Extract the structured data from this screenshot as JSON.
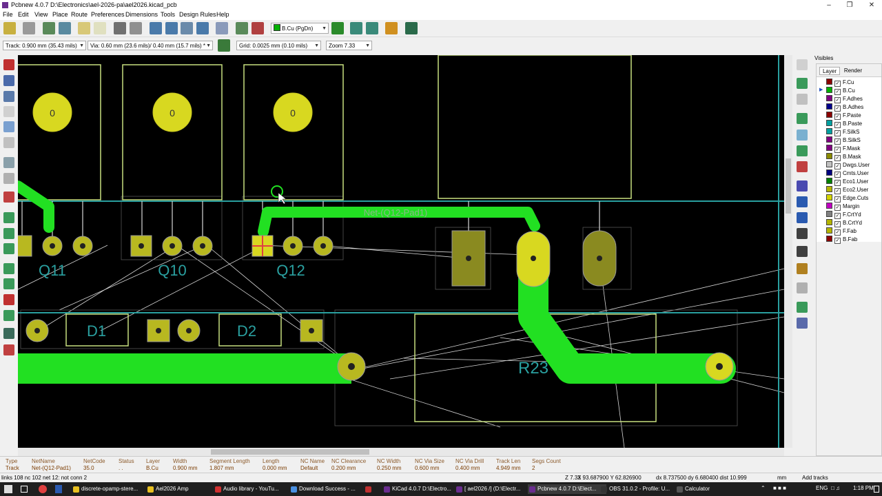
{
  "window": {
    "title": "Pcbnew 4.0.7 D:\\Electronics\\ael-2026-pa\\ael2026.kicad_pcb",
    "minimize": "–",
    "maximize": "❐",
    "close": "✕"
  },
  "menu": [
    "File",
    "Edit",
    "View",
    "Place",
    "Route",
    "Preferences",
    "Dimensions",
    "Tools",
    "Design Rules",
    "Help"
  ],
  "toolbar": {
    "layer_select": "B.Cu (PgDn)",
    "track_select": "Track: 0.900 mm (35.43 mils)",
    "via_select": "Via: 0.60 mm (23.6 mils)/ 0.40 mm (15.7 mils) *",
    "grid_select": "Grid: 0.0025 mm (0.10 mils)",
    "zoom_select": "Zoom 7.33"
  },
  "pcb": {
    "net_label": "Net-(Q12-Pad1)",
    "pad_number": "0",
    "refs": [
      "Q11",
      "Q10",
      "Q12",
      "D1",
      "D2",
      "R23"
    ]
  },
  "layers_panel": {
    "title": "Visibles",
    "tabs": [
      "Layer",
      "Render"
    ],
    "active_tab": "Layer",
    "current_layer": "B.Cu",
    "layers": [
      {
        "name": "F.Cu",
        "color": "#8b0000"
      },
      {
        "name": "B.Cu",
        "color": "#00b000"
      },
      {
        "name": "F.Adhes",
        "color": "#800080"
      },
      {
        "name": "B.Adhes",
        "color": "#00008b"
      },
      {
        "name": "F.Paste",
        "color": "#8b0000"
      },
      {
        "name": "B.Paste",
        "color": "#00a0a0"
      },
      {
        "name": "F.SilkS",
        "color": "#00a0a0"
      },
      {
        "name": "B.SilkS",
        "color": "#800080"
      },
      {
        "name": "F.Mask",
        "color": "#800080"
      },
      {
        "name": "B.Mask",
        "color": "#8b8b00"
      },
      {
        "name": "Dwgs.User",
        "color": "#c0c0c0"
      },
      {
        "name": "Cmts.User",
        "color": "#000080"
      },
      {
        "name": "Eco1.User",
        "color": "#008000"
      },
      {
        "name": "Eco2.User",
        "color": "#b5b500"
      },
      {
        "name": "Edge.Cuts",
        "color": "#d4d400"
      },
      {
        "name": "Margin",
        "color": "#c000c0"
      },
      {
        "name": "F.CrtYd",
        "color": "#808080"
      },
      {
        "name": "B.CrtYd",
        "color": "#b5b500"
      },
      {
        "name": "F.Fab",
        "color": "#b5b500"
      },
      {
        "name": "B.Fab",
        "color": "#8b0000"
      }
    ]
  },
  "msg_panel": [
    {
      "h": "Type",
      "v": "Track"
    },
    {
      "h": "NetName",
      "v": "Net-(Q12-Pad1)"
    },
    {
      "h": "NetCode",
      "v": "35.0"
    },
    {
      "h": "Status",
      "v": ". ."
    },
    {
      "h": "Layer",
      "v": "B.Cu"
    },
    {
      "h": "Width",
      "v": "0.900 mm"
    },
    {
      "h": "Segment Length",
      "v": "1.807 mm"
    },
    {
      "h": "Length",
      "v": "0.000 mm"
    },
    {
      "h": "NC Name",
      "v": "Default"
    },
    {
      "h": "NC Clearance",
      "v": "0.200 mm"
    },
    {
      "h": "NC Width",
      "v": "0.250 mm"
    },
    {
      "h": "NC Via Size",
      "v": "0.600 mm"
    },
    {
      "h": "NC Via Drill",
      "v": "0.400 mm"
    },
    {
      "h": "Track Len",
      "v": "4.949 mm"
    },
    {
      "h": "Segs Count",
      "v": "2"
    }
  ],
  "status": {
    "links": "links 108 nc 102  net 12: not conn 2",
    "zoom": "Z 7.33",
    "abs_coords": "X 93.687900  Y 62.826900",
    "rel_coords": "dx 8.737500  dy 6.680400  dist 10.999",
    "units": "mm",
    "mode": "Add tracks"
  },
  "taskbar": {
    "apps": [
      {
        "label": "discrete-opamp-stere...",
        "color": "#e8c020"
      },
      {
        "label": "Ael2026 Amp",
        "color": "#e8c020"
      },
      {
        "label": "Audio library - YouTu...",
        "color": "#d03030"
      },
      {
        "label": "Download Success - ...",
        "color": "#4a90e2"
      },
      {
        "label": "",
        "color": "#c03030"
      },
      {
        "label": "KiCad 4.0.7 D:\\Electro...",
        "color": "#6a2d8f"
      },
      {
        "label": "[ ael2026 /] (D:\\Electr...",
        "color": "#6a2d8f"
      },
      {
        "label": "Pcbnew 4.0.7 D:\\Elect...",
        "color": "#6a2d8f"
      },
      {
        "label": "OBS 31.0.2 - Profile: U...",
        "color": "#333"
      },
      {
        "label": "Calculator",
        "color": "#555"
      }
    ],
    "lang": "ENG",
    "time": "1:18 PM"
  }
}
